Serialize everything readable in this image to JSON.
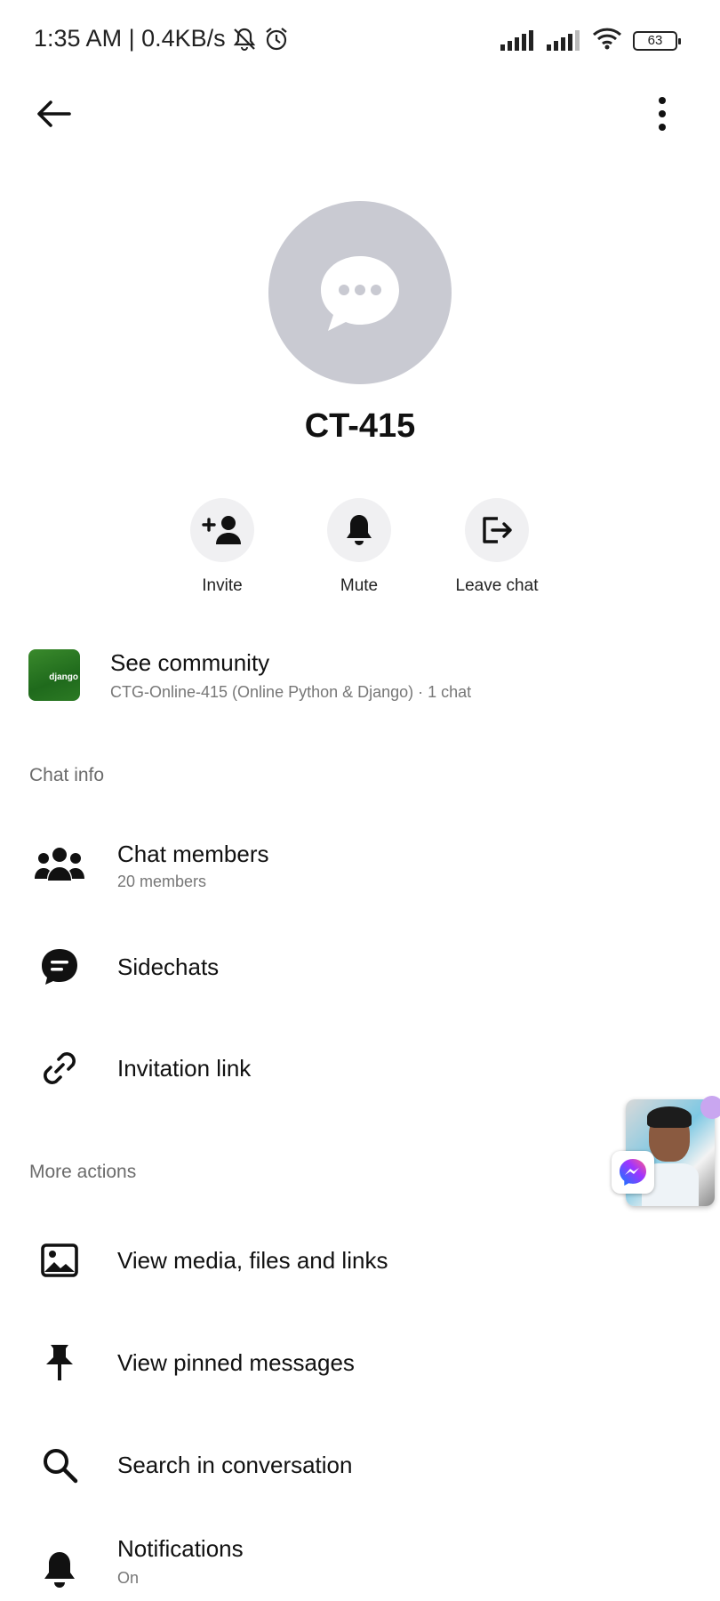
{
  "status_bar": {
    "time_speed": "1:35 AM | 0.4KB/s",
    "battery": "63"
  },
  "header": {
    "title": "CT-415"
  },
  "actions": [
    {
      "label": "Invite",
      "icon": "add-person-icon"
    },
    {
      "label": "Mute",
      "icon": "bell-icon"
    },
    {
      "label": "Leave chat",
      "icon": "leave-icon"
    }
  ],
  "community": {
    "title": "See community",
    "subtitle": "CTG-Online-415 (Online  Python & Django) · 1 chat",
    "thumb_text": "django"
  },
  "chat_info": {
    "header": "Chat info",
    "items": [
      {
        "title": "Chat members",
        "subtitle": "20 members",
        "icon": "people-icon"
      },
      {
        "title": "Sidechats",
        "icon": "chat-bubble-icon"
      },
      {
        "title": "Invitation link",
        "icon": "link-icon"
      }
    ]
  },
  "more_actions": {
    "header": "More actions",
    "items": [
      {
        "title": "View media, files and links",
        "icon": "image-icon"
      },
      {
        "title": "View pinned messages",
        "icon": "pin-icon"
      },
      {
        "title": "Search in conversation",
        "icon": "search-icon"
      },
      {
        "title": "Notifications",
        "subtitle": "On",
        "icon": "bell-icon"
      }
    ]
  }
}
